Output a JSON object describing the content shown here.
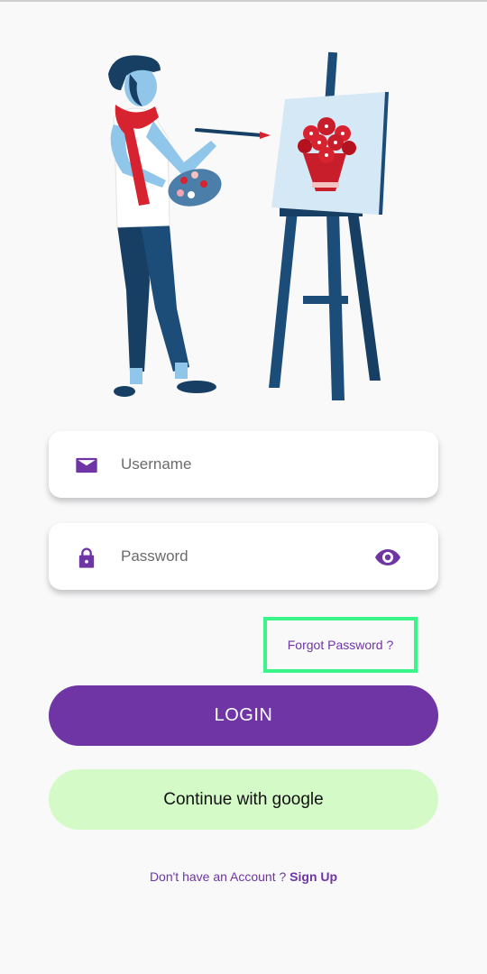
{
  "login_form": {
    "username_placeholder": "Username",
    "password_placeholder": "Password",
    "forgot_password": "Forgot Password ?",
    "login_button": "LOGIN",
    "google_button": "Continue with google",
    "no_account_text": "Don't have an Account ? ",
    "signup_link": "Sign Up"
  },
  "icons": {
    "username": "mail-icon",
    "password": "lock-icon",
    "toggle_visibility": "eye-icon",
    "hero": "painter-illustration"
  },
  "colors": {
    "primary": "#6f35a5",
    "google_button_bg": "#d4fac7",
    "highlight_border": "#3cf58a",
    "background": "#f9f9fa"
  }
}
